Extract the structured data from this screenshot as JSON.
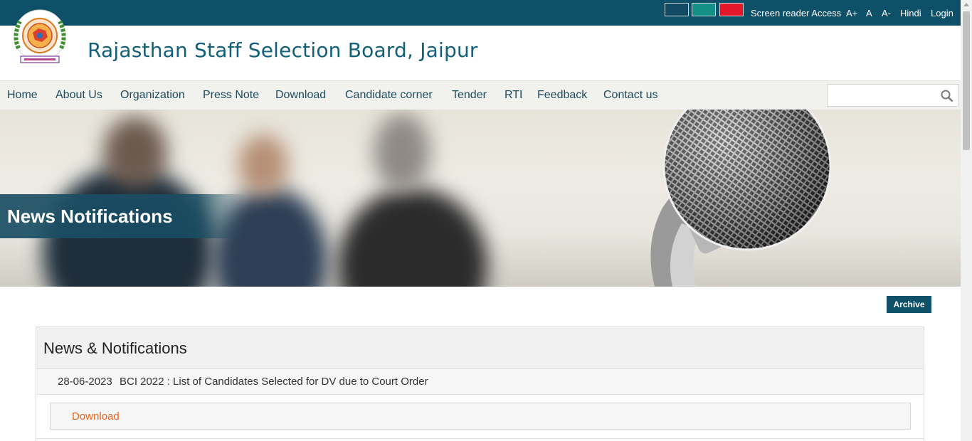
{
  "topbar": {
    "colors": [
      "#134a63",
      "#148f86",
      "#e3172a"
    ],
    "screen_reader": "Screen reader Access",
    "font_increase": "A+",
    "font_normal": "A",
    "font_decrease": "A-",
    "hindi": "Hindi",
    "login": "Login"
  },
  "header": {
    "title": "Rajasthan Staff Selection Board, Jaipur",
    "logo_icon": "rssb-emblem-icon"
  },
  "nav": {
    "items": [
      {
        "label": "Home"
      },
      {
        "label": "About Us"
      },
      {
        "label": "Organization"
      },
      {
        "label": "Press Note"
      },
      {
        "label": "Download"
      },
      {
        "label": "Candidate corner"
      },
      {
        "label": "Tender"
      },
      {
        "label": "RTI"
      },
      {
        "label": "Feedback"
      },
      {
        "label": "Contact us"
      }
    ],
    "search_placeholder": "",
    "search_icon": "search-icon"
  },
  "banner": {
    "title": "News Notifications"
  },
  "archive_label": "Archive",
  "news": {
    "heading": "News & Notifications",
    "items": [
      {
        "date": "28-06-2023",
        "title": "BCI 2022 : List of Candidates Selected for DV due to Court Order",
        "link_label": "Download"
      }
    ]
  },
  "colors": {
    "brand": "#0e5068",
    "link": "#e8641c"
  }
}
